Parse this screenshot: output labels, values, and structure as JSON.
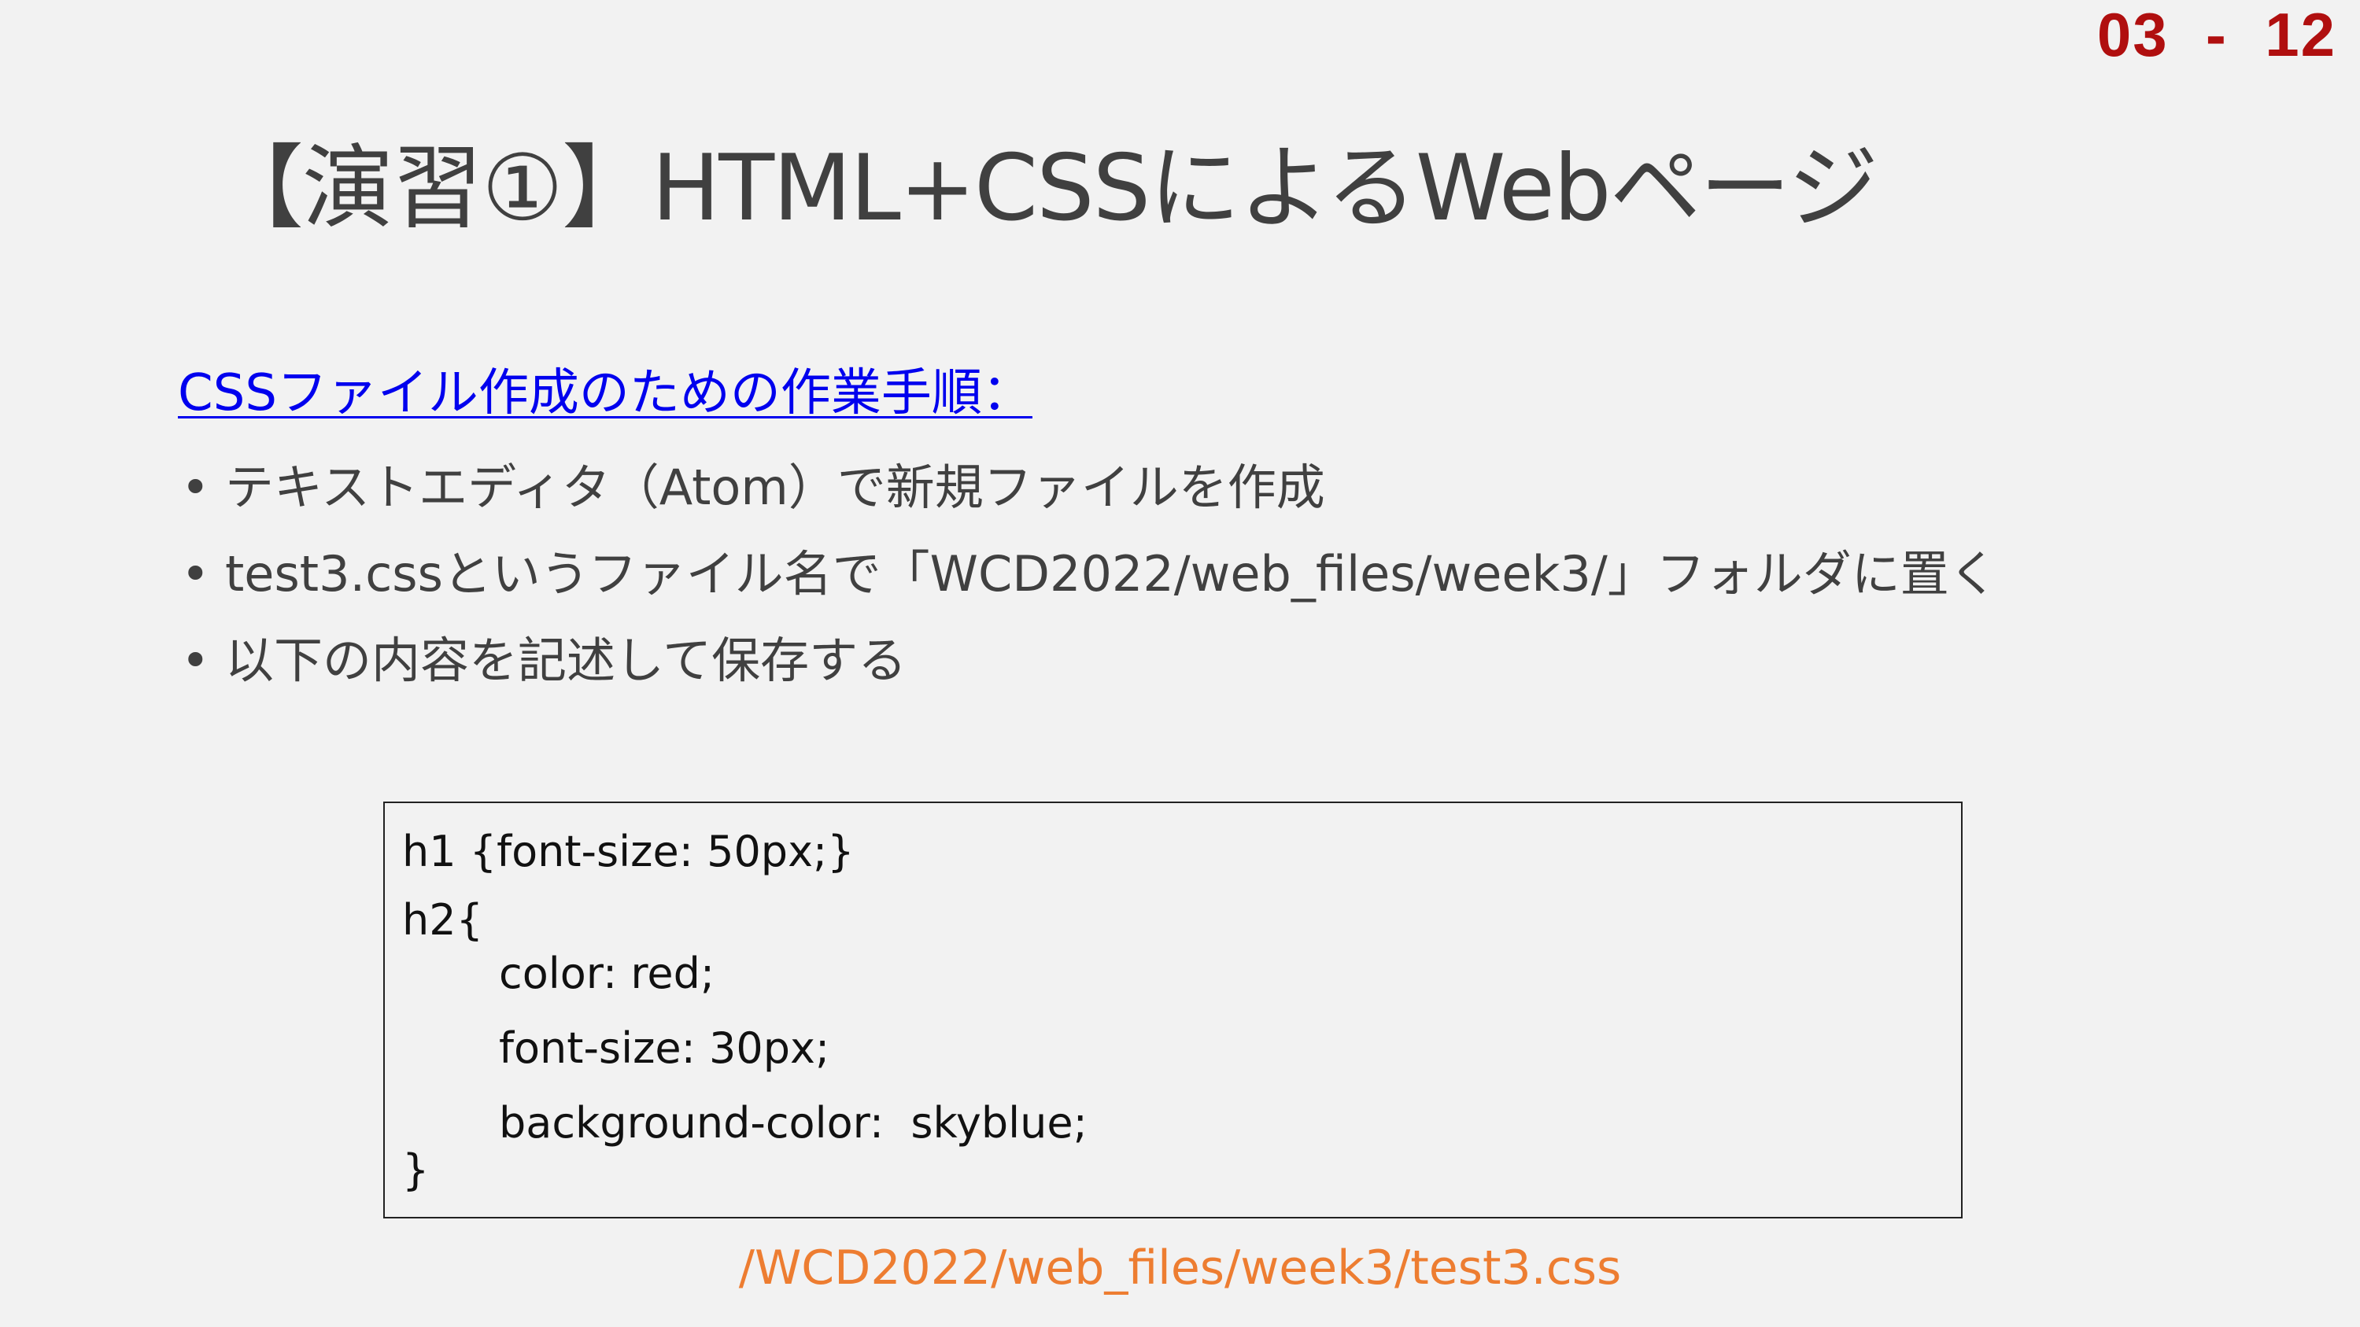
{
  "page_number": "03  -  12",
  "title": "【演習①】HTML+CSSによるWebページ",
  "section_link": "CSSファイル作成のための作業手順：",
  "bullets": [
    "テキストエディタ（Atom）で新規ファイルを作成",
    "test3.cssというファイル名で「WCD2022/web_files/week3/」フォルダに置く",
    "以下の内容を記述して保存する"
  ],
  "bullet_symbol": "•",
  "code": {
    "line1": "h1 {font-size: 50px;}",
    "line2": "h2{",
    "line3": "color: red;",
    "line4": "font-size: 30px;",
    "line5": "background-color:  skyblue;",
    "line6": "}"
  },
  "file_path": "/WCD2022/web_files/week3/test3.css",
  "colors": {
    "background": "#f2f2f2",
    "page_number": "#b00f0f",
    "title_text": "#404040",
    "link": "#0000ee",
    "file_path": "#ed7d31"
  }
}
